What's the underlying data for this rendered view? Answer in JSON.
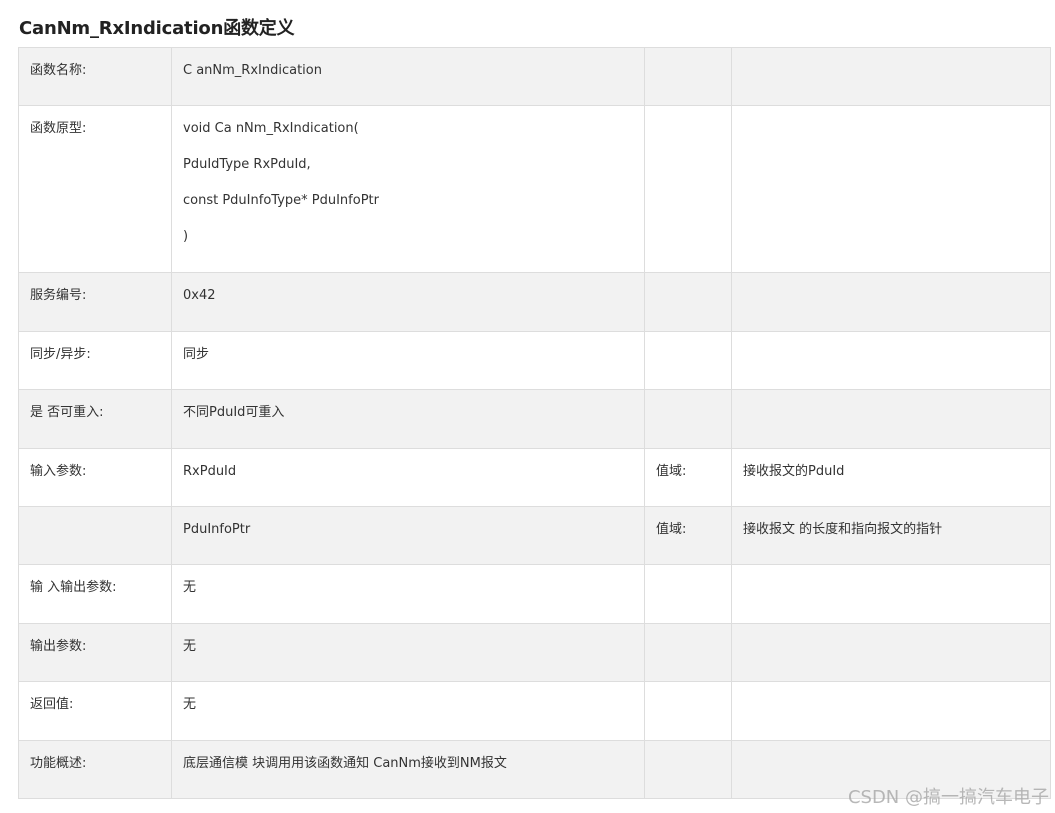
{
  "title": "CanNm_RxIndication函数定义",
  "rows": [
    {
      "label": "函数名称:",
      "value": "C anNm_RxIndication",
      "c3": "",
      "c4": ""
    },
    {
      "label": "函数原型:",
      "value_lines": [
        "void Ca nNm_RxIndication(",
        "PduIdType RxPduId,",
        "const PduInfoType* PduInfoPtr",
        ")"
      ],
      "c3": "",
      "c4": ""
    },
    {
      "label": "服务编号:",
      "value": "0x42",
      "c3": "",
      "c4": ""
    },
    {
      "label": "同步/异步:",
      "value": "同步",
      "c3": "",
      "c4": ""
    },
    {
      "label": "是 否可重入:",
      "value": "不同PduId可重入",
      "c3": "",
      "c4": ""
    },
    {
      "label": "输入参数:",
      "value": "RxPduId",
      "c3": "值域:",
      "c4": "接收报文的PduId"
    },
    {
      "label": "",
      "value": "PduInfoPtr",
      "c3": "值域:",
      "c4": "接收报文 的长度和指向报文的指针"
    },
    {
      "label": "输 入输出参数:",
      "value": "无",
      "c3": "",
      "c4": ""
    },
    {
      "label": "输出参数:",
      "value": "无",
      "c3": "",
      "c4": ""
    },
    {
      "label": "返回值:",
      "value": "无",
      "c3": "",
      "c4": ""
    },
    {
      "label": "功能概述:",
      "value": "底层通信模 块调用用该函数通知 CanNm接收到NM报文",
      "c3": "",
      "c4": ""
    }
  ],
  "watermark": "CSDN @搞一搞汽车电子"
}
